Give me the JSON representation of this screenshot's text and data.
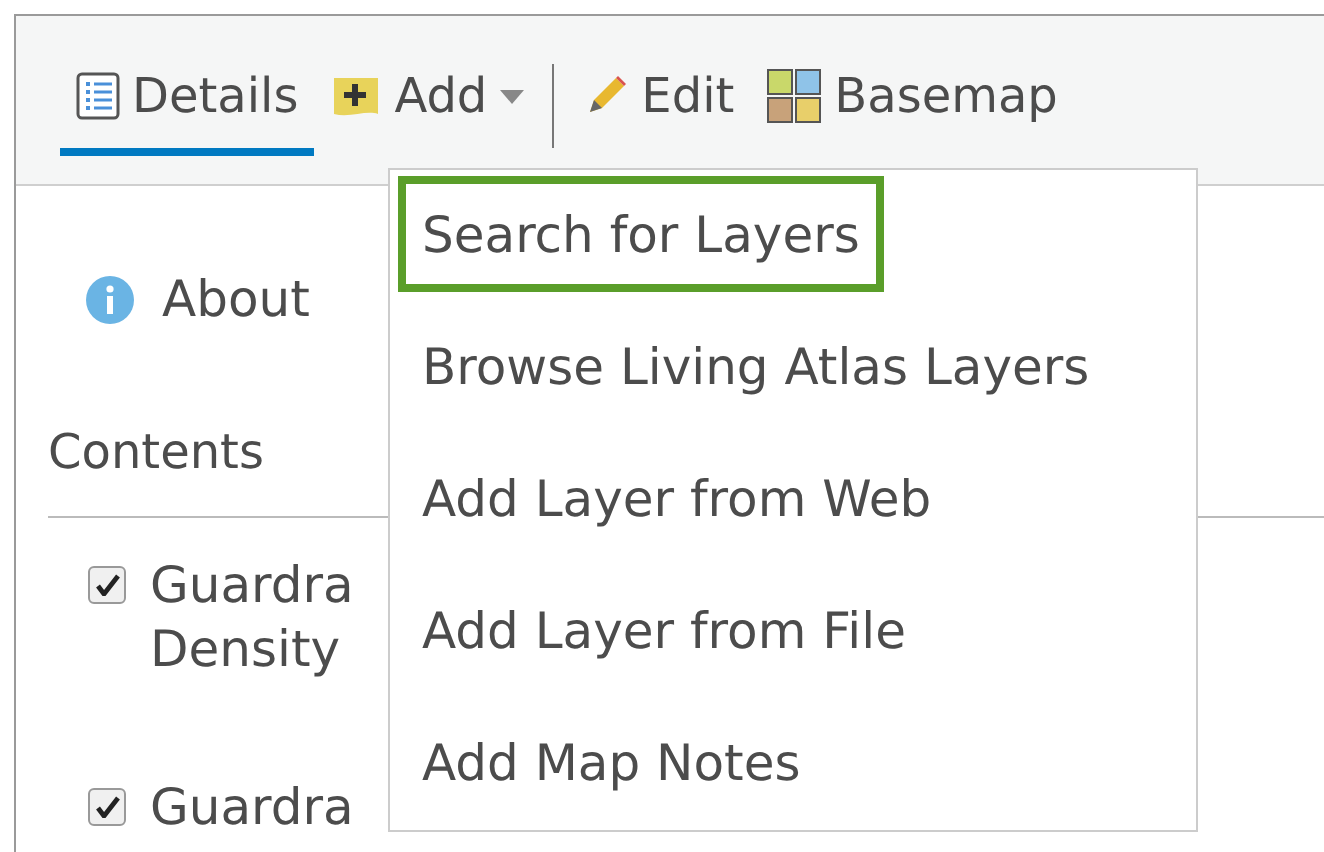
{
  "toolbar": {
    "tabs": [
      {
        "label": "Details",
        "selected": true
      },
      {
        "label": "Add",
        "selected": false
      },
      {
        "label": "Edit",
        "selected": false
      },
      {
        "label": "Basemap",
        "selected": false
      }
    ]
  },
  "panel": {
    "about": "About",
    "contents_heading": "Contents",
    "layers": [
      {
        "lines": [
          "Guardra",
          "Density"
        ],
        "checked": true
      },
      {
        "lines": [
          "Guardra"
        ],
        "checked": true
      }
    ]
  },
  "add_menu": {
    "items": [
      {
        "label": "Search for Layers",
        "selected": true
      },
      {
        "label": "Browse Living Atlas Layers",
        "selected": false
      },
      {
        "label": "Add Layer from Web",
        "selected": false
      },
      {
        "label": "Add Layer from File",
        "selected": false
      },
      {
        "label": "Add Map Notes",
        "selected": false
      }
    ]
  }
}
